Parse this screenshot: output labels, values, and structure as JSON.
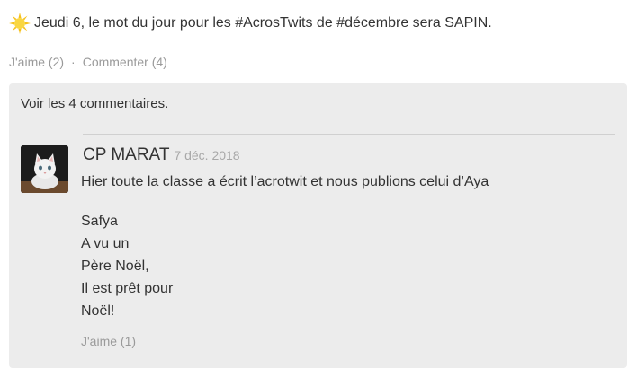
{
  "post": {
    "icon": "sun-icon",
    "text": "Jeudi 6, le mot du jour pour les #AcrosTwits de #décembre sera SAPIN.",
    "like_label": "J'aime (2)",
    "separator": "·",
    "comment_label": "Commenter (4)"
  },
  "comments": {
    "view_all": "Voir les 4 commentaires.",
    "items": [
      {
        "avatar": "cat-avatar",
        "author": "CP MARAT",
        "date": "7 déc. 2018",
        "text": "Hier toute la classe a écrit l’acrotwit et nous publions celui d’Aya",
        "poem": [
          "Safya",
          "A vu un",
          "Père Noël,",
          "Il est prêt pour",
          "Noël!"
        ],
        "like_label": "J'aime (1)"
      }
    ]
  },
  "colors": {
    "muted": "#9a9a9a",
    "panel": "#ececec",
    "text": "#333333"
  }
}
